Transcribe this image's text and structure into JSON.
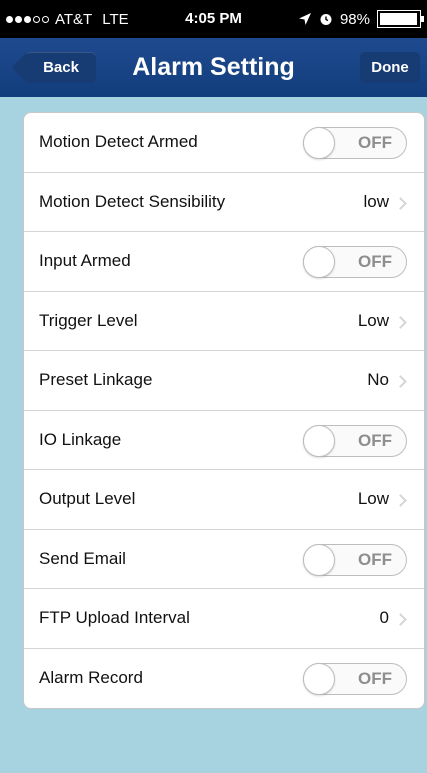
{
  "status_bar": {
    "carrier": "AT&T",
    "network": "LTE",
    "time": "4:05 PM",
    "battery": "98%",
    "signal_bars_filled": 3,
    "signal_bars_total": 5,
    "battery_level": 0.98,
    "location_icon": "location-arrow-icon",
    "alarm_icon": "alarm-clock-icon"
  },
  "nav": {
    "title": "Alarm Setting",
    "back_label": "Back",
    "done_label": "Done"
  },
  "toggle_text": "OFF",
  "colors": {
    "nav_bar": "#1a4587",
    "background": "#a6d3df",
    "toggle_text": "#8e8e8e"
  },
  "settings": [
    {
      "label": "Motion Detect Armed",
      "type": "toggle",
      "value": "OFF"
    },
    {
      "label": "Motion Detect Sensibility",
      "type": "select",
      "value": "low"
    },
    {
      "label": "Input Armed",
      "type": "toggle",
      "value": "OFF"
    },
    {
      "label": "Trigger Level",
      "type": "select",
      "value": "Low"
    },
    {
      "label": "Preset Linkage",
      "type": "select",
      "value": "No"
    },
    {
      "label": "IO Linkage",
      "type": "toggle",
      "value": "OFF"
    },
    {
      "label": "Output Level",
      "type": "select",
      "value": "Low"
    },
    {
      "label": "Send Email",
      "type": "toggle",
      "value": "OFF"
    },
    {
      "label": "FTP Upload Interval",
      "type": "select",
      "value": "0"
    },
    {
      "label": "Alarm Record",
      "type": "toggle",
      "value": "OFF"
    }
  ]
}
